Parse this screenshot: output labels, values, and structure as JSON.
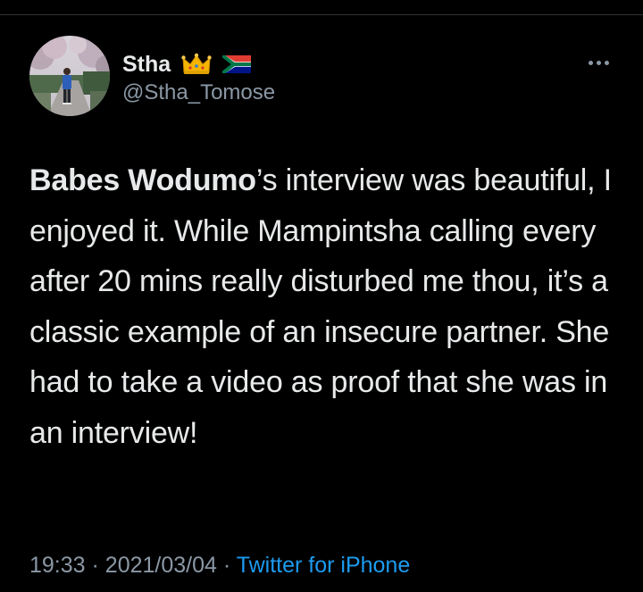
{
  "author": {
    "display_name": "Stha",
    "handle": "@Stha_Tomose",
    "avatar": "profile-photo-person-in-park",
    "badges": [
      "crown-emoji",
      "south-africa-flag-emoji"
    ]
  },
  "tweet": {
    "text_bold_lead": "Babes Wodumo",
    "text_rest": "’s interview was beautiful, I enjoyed it. While Mampintsha calling every after 20 mins really disturbed me thou, it’s a classic example of an insecure partner. She had to take a video as proof that she was in an interview!",
    "time": "19:33",
    "separator": "·",
    "date": "2021/03/04",
    "source": "Twitter for iPhone"
  },
  "menu": {
    "more_icon": "ellipsis-icon"
  },
  "colors": {
    "background": "#000000",
    "text": "#e7e9ea",
    "secondary": "#8b98a5",
    "link": "#1d9bf0",
    "divider": "#2f3336"
  }
}
